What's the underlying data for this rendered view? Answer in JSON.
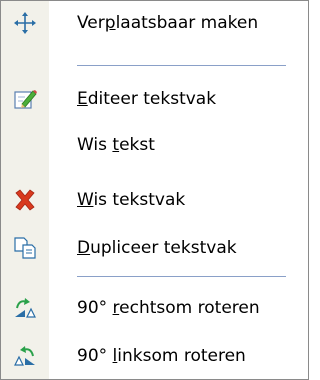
{
  "menu": {
    "items": [
      {
        "id": "move",
        "label": "Verplaatsbaar maken",
        "icon": "move-arrows-icon",
        "mnemonic_char_index": 3
      },
      {
        "id": "edit",
        "label": "Editeer tekstvak",
        "icon": "edit-pencil-icon",
        "mnemonic_char_index": 0
      },
      {
        "id": "clear",
        "label": "Wis tekst",
        "icon": "",
        "mnemonic_char_index": 4
      },
      {
        "id": "delete",
        "label": "Wis tekstvak",
        "icon": "red-x-delete-icon",
        "mnemonic_char_index": 0
      },
      {
        "id": "duplicate",
        "label": "Dupliceer tekstvak",
        "icon": "duplicate-pages-icon",
        "mnemonic_char_index": 0
      },
      {
        "id": "rotate-cw",
        "label": "90° rechtsom roteren",
        "icon": "rotate-clockwise-icon",
        "mnemonic_char_index": 4
      },
      {
        "id": "rotate-ccw",
        "label": "90° linksom roteren",
        "icon": "rotate-counterclockwise-icon",
        "mnemonic_char_index": 4
      }
    ]
  }
}
